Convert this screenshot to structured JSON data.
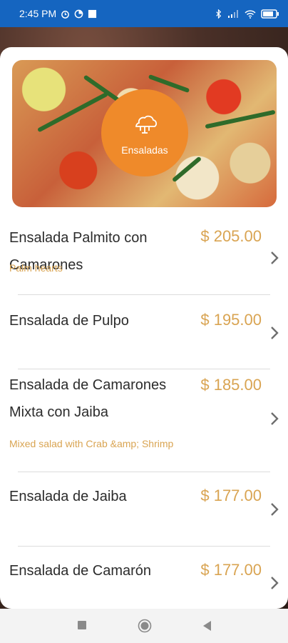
{
  "status": {
    "time": "2:45 PM",
    "battery_color": "#ffffff"
  },
  "hero": {
    "badge_label": "Ensaladas",
    "badge_icon": "salad-bowl-icon",
    "accent_color": "#ef8a2a"
  },
  "items": [
    {
      "name": "Ensalada Palmito con Camarones",
      "price": "$ 205.00",
      "description": "Palm hearts"
    },
    {
      "name": "Ensalada de Pulpo",
      "price": "$ 195.00",
      "description": ""
    },
    {
      "name": "Ensalada de Camarones Mixta con Jaiba",
      "price": "$ 185.00",
      "description": "Mixed salad with Crab &amp; Shrimp"
    },
    {
      "name": "Ensalada de Jaiba",
      "price": "$ 177.00",
      "description": ""
    },
    {
      "name": "Ensalada de Camarón",
      "price": "$ 177.00",
      "description": ""
    }
  ],
  "colors": {
    "price": "#d9a452",
    "status_bar": "#1565c0"
  }
}
